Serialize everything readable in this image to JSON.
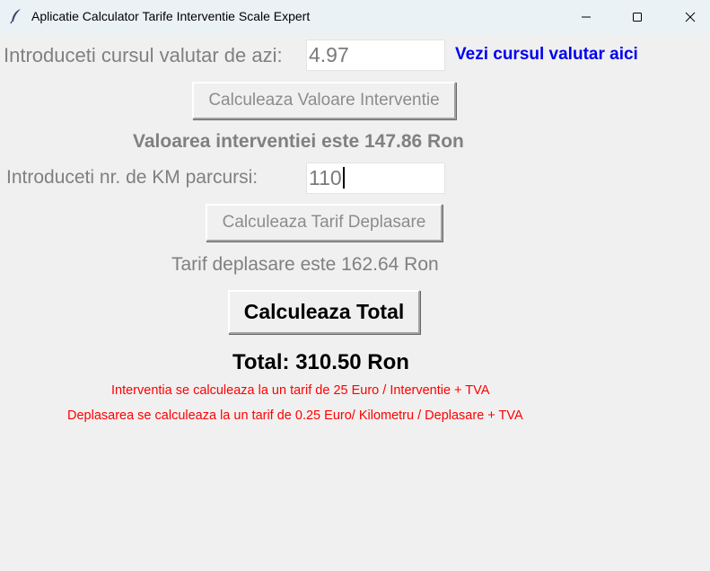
{
  "window": {
    "title": "Aplicatie Calculator Tarife Interventie Scale Expert",
    "controls": {
      "minimize_icon": "minimize-icon",
      "maximize_icon": "maximize-icon",
      "close_icon": "close-icon"
    }
  },
  "exchange": {
    "label": "Introduceti cursul valutar de azi:",
    "value": "4.97",
    "link_text": "Vezi cursul valutar aici",
    "link_color": "#0000ee"
  },
  "intervention": {
    "button_label": "Calculeaza Valoare Interventie",
    "result": "Valoarea interventiei este 147.86 Ron"
  },
  "distance": {
    "label": "Introduceti nr. de KM parcursi:",
    "value": "110",
    "button_label": "Calculeaza Tarif Deplasare",
    "result": "Tarif deplasare este 162.64 Ron"
  },
  "total": {
    "button_label": "Calculeaza Total",
    "result": "Total: 310.50 Ron"
  },
  "notes": {
    "color": "#ff0000",
    "intervention_note": "Interventia se calculeaza la un tarif de 25 Euro / Interventie + TVA",
    "travel_note": "Deplasarea se calculeaza la un tarif de 0.25 Euro/ Kilometru / Deplasare + TVA"
  }
}
